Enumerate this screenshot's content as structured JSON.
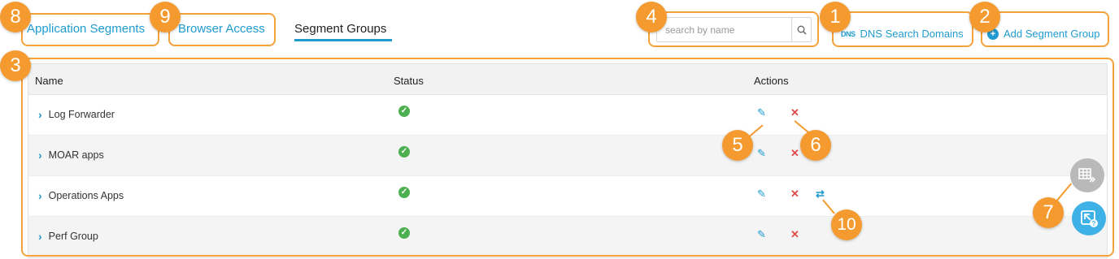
{
  "tabs": {
    "application_segments": "Application Segments",
    "browser_access": "Browser Access",
    "segment_groups": "Segment Groups"
  },
  "search": {
    "placeholder": "search by name"
  },
  "toolbar": {
    "dns_icon_text": "DNS",
    "dns_search_domains": "DNS Search Domains",
    "add_segment_group": "Add Segment Group"
  },
  "table": {
    "columns": {
      "name": "Name",
      "status": "Status",
      "actions": "Actions"
    },
    "rows": [
      {
        "name": "Log Forwarder",
        "status": "active"
      },
      {
        "name": "MOAR apps",
        "status": "active"
      },
      {
        "name": "Operations Apps",
        "status": "active"
      },
      {
        "name": "Perf Group",
        "status": "active"
      }
    ]
  },
  "badges": [
    "1",
    "2",
    "3",
    "4",
    "5",
    "6",
    "7",
    "8",
    "9",
    "10"
  ],
  "colors": {
    "accent": "#1f9bcf",
    "highlight": "#f59a2e",
    "delete": "#e04a4a",
    "success": "#4caf50"
  }
}
